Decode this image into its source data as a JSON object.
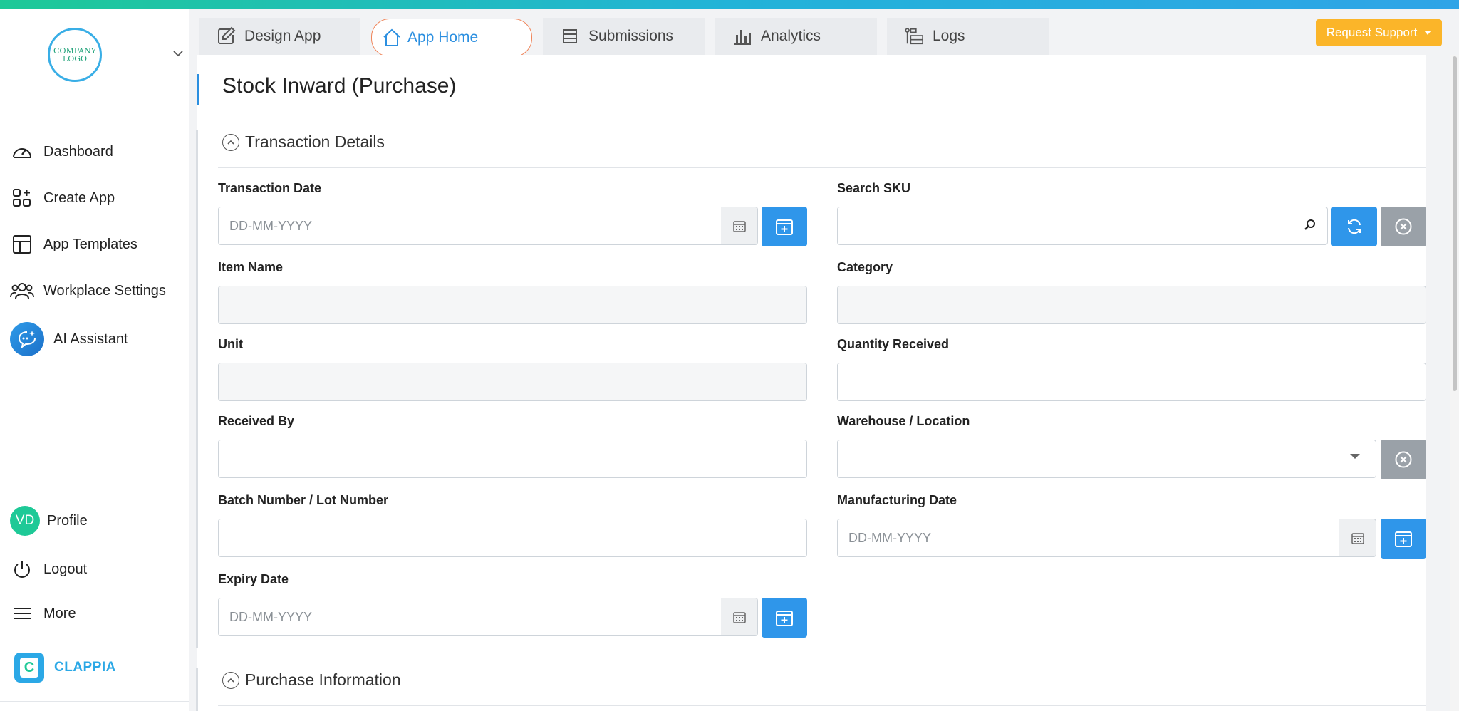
{
  "sidebar": {
    "logo_text": "COMPANY LOGO",
    "items": [
      {
        "label": "Dashboard",
        "icon": "dashboard-icon"
      },
      {
        "label": "Create App",
        "icon": "create-app-icon"
      },
      {
        "label": "App Templates",
        "icon": "templates-icon"
      },
      {
        "label": "Workplace Settings",
        "icon": "users-icon"
      },
      {
        "label": "AI Assistant",
        "icon": "ai-assistant-icon"
      }
    ],
    "bottom": [
      {
        "label": "Profile",
        "avatar": "VD"
      },
      {
        "label": "Logout",
        "icon": "power-icon"
      },
      {
        "label": "More",
        "icon": "menu-icon"
      }
    ],
    "brand": "CLAPPIA"
  },
  "tabs": [
    {
      "label": "Design App",
      "icon": "edit-icon"
    },
    {
      "label": "App Home",
      "icon": "home-icon",
      "active": true
    },
    {
      "label": "Submissions",
      "icon": "list-icon"
    },
    {
      "label": "Analytics",
      "icon": "bar-chart-icon"
    },
    {
      "label": "Logs",
      "icon": "logs-icon"
    }
  ],
  "support_button": "Request Support",
  "page_title": "Stock Inward (Purchase)",
  "sections": {
    "transaction": "Transaction Details",
    "purchase": "Purchase Information"
  },
  "fields": {
    "transaction_date": {
      "label": "Transaction Date",
      "placeholder": "DD-MM-YYYY"
    },
    "search_sku": {
      "label": "Search SKU",
      "value": ""
    },
    "item_name": {
      "label": "Item Name",
      "value": ""
    },
    "category": {
      "label": "Category",
      "value": ""
    },
    "unit": {
      "label": "Unit",
      "value": ""
    },
    "quantity_received": {
      "label": "Quantity Received",
      "value": ""
    },
    "received_by": {
      "label": "Received By",
      "value": ""
    },
    "warehouse": {
      "label": "Warehouse / Location",
      "value": ""
    },
    "batch_number": {
      "label": "Batch Number / Lot Number",
      "value": ""
    },
    "manufacturing_date": {
      "label": "Manufacturing Date",
      "placeholder": "DD-MM-YYYY"
    },
    "expiry_date": {
      "label": "Expiry Date",
      "placeholder": "DD-MM-YYYY"
    }
  },
  "colors": {
    "accent": "#2f96ea",
    "support": "#fbb529",
    "brand": "#2ba8e6",
    "avatar": "#1ec997"
  }
}
